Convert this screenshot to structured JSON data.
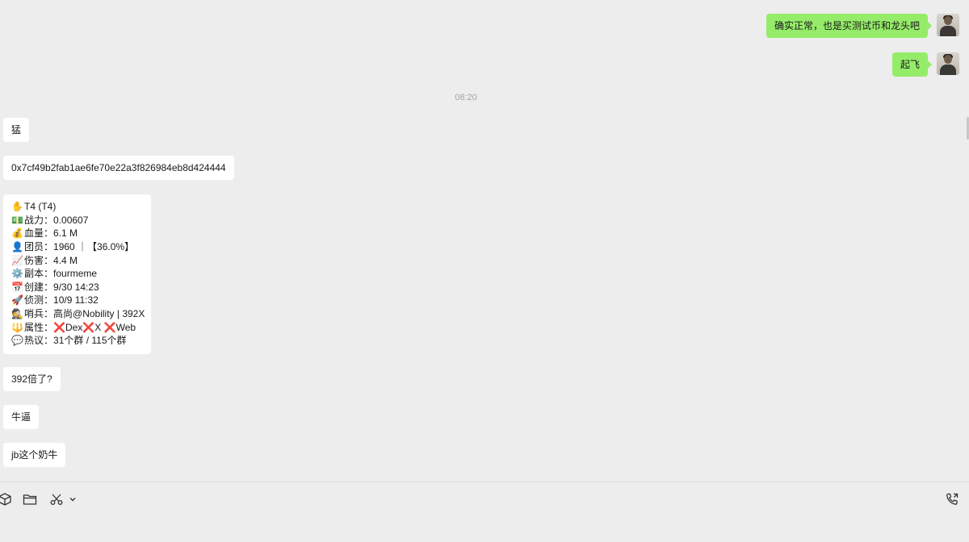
{
  "outgoing": [
    {
      "text": "确实正常，也是买测试币和龙头吧"
    },
    {
      "text": "起飞"
    }
  ],
  "timestamp": "08:20",
  "incoming": {
    "m1": "猛",
    "m2": "0x7cf49b2fab1ae6fe70e22a3f826984eb8d424444",
    "card": {
      "title": "T4 (T4)",
      "power_label": "战力：",
      "power_value": "0.00607",
      "blood_label": "血量：",
      "blood_value": "6.1 M",
      "members_label": "团员：",
      "members_value": "1960 ｜【36.0%】",
      "damage_label": "伤害：",
      "damage_value": "4.4 M",
      "dungeon_label": "副本：",
      "dungeon_value": "fourmeme",
      "created_label": "创建：",
      "created_value": "9/30 14:23",
      "detected_label": "侦测：",
      "detected_value": "10/9 11:32",
      "sentry_label": "哨兵：",
      "sentry_value": "高尚@Nobility | 392X",
      "attr_label": "属性：",
      "attr_dex": "Dex",
      "attr_x": "X",
      "attr_web": "Web",
      "discuss_label": "热议：",
      "discuss_value": "31个群 / 115个群"
    },
    "m3": "392倍了?",
    "m4": "牛逼",
    "m5": "jb这个奶牛"
  },
  "icons": {
    "card_hand": "✋",
    "card_money": "💵",
    "card_bag": "💰",
    "card_person": "👤",
    "card_chart": "📈",
    "card_gear": "⚙️",
    "card_calendar": "📅",
    "card_rocket": "🚀",
    "card_detective": "🕵",
    "card_trident": "🔱",
    "card_bubble": "💬",
    "card_cross": "❌"
  },
  "colors": {
    "background": "#ededed",
    "outgoing_bubble": "#95ec69",
    "incoming_bubble": "#ffffff",
    "cross_red": "#e53935"
  }
}
